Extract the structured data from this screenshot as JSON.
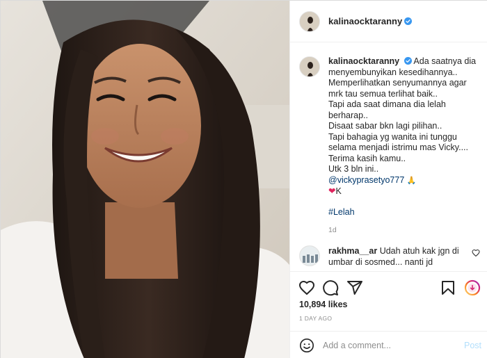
{
  "post": {
    "username": "kalinaocktaranny",
    "verified": true,
    "caption_lines": [
      "Ada saatnya dia",
      "menyembunyikan kesedihannya..",
      "Memperlihatkan senyumannya agar",
      "mrk tau semua terlihat baik..",
      "Tapi ada saat dimana dia lelah",
      "berharap..",
      "Disaat sabar bkn lagi pilihan..",
      "Tapi bahagia yg wanita ini tunggu",
      "selama menjadi istrimu mas Vicky....",
      "Terima kasih kamu..",
      "Utk 3 bln ini.."
    ],
    "mention": "@vickyprasetyo777",
    "pray_emoji": "🙏",
    "heart_emoji": "❤",
    "heart_text": "K",
    "hashtag": "#Lelah",
    "caption_time": "1d",
    "likes": "10,894 likes",
    "posted_ago": "1 DAY AGO"
  },
  "comments": [
    {
      "username": "rakhma__ar",
      "text_lines": [
        "Udah atuh kak jgn di",
        "umbar di sosmed... nanti jd"
      ]
    }
  ],
  "actions": {
    "icons": [
      "heart-icon",
      "comment-icon",
      "share-icon",
      "bookmark-icon",
      "reel-icon"
    ]
  },
  "add_comment": {
    "placeholder": "Add a comment...",
    "post_label": "Post"
  },
  "colors": {
    "verified_blue": "#3897f0",
    "link_blue": "#00376b",
    "post_disabled": "#b2dffc",
    "muted": "#8e8e8e",
    "heart_red": "#e0245e"
  }
}
